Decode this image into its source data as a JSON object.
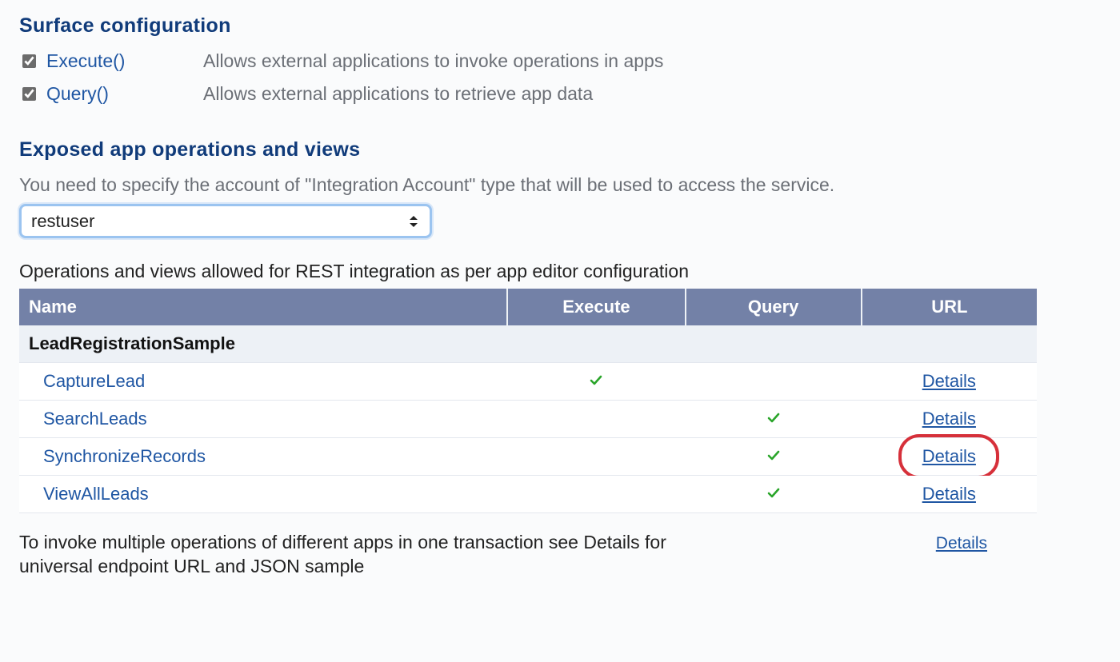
{
  "surface": {
    "title": "Surface configuration",
    "items": [
      {
        "checked": true,
        "name": "Execute()",
        "desc": "Allows external applications to invoke operations in apps"
      },
      {
        "checked": true,
        "name": "Query()",
        "desc": "Allows external applications to retrieve app data"
      }
    ]
  },
  "exposed": {
    "title": "Exposed app operations and views",
    "helper": "You need to specify the account of \"Integration Account\" type that will be used to access the service.",
    "selected_account": "restuser",
    "caption": "Operations and views allowed for REST integration as per app editor configuration",
    "columns": {
      "name": "Name",
      "execute": "Execute",
      "query": "Query",
      "url": "URL"
    },
    "group": "LeadRegistrationSample",
    "rows": [
      {
        "name": "CaptureLead",
        "execute": true,
        "query": false,
        "details": "Details",
        "highlighted": false
      },
      {
        "name": "SearchLeads",
        "execute": false,
        "query": true,
        "details": "Details",
        "highlighted": false
      },
      {
        "name": "SynchronizeRecords",
        "execute": false,
        "query": true,
        "details": "Details",
        "highlighted": true
      },
      {
        "name": "ViewAllLeads",
        "execute": false,
        "query": true,
        "details": "Details",
        "highlighted": false
      }
    ],
    "footer": {
      "text": "To invoke multiple operations of different apps in one transaction see Details for universal endpoint URL and JSON sample",
      "details": "Details"
    }
  }
}
